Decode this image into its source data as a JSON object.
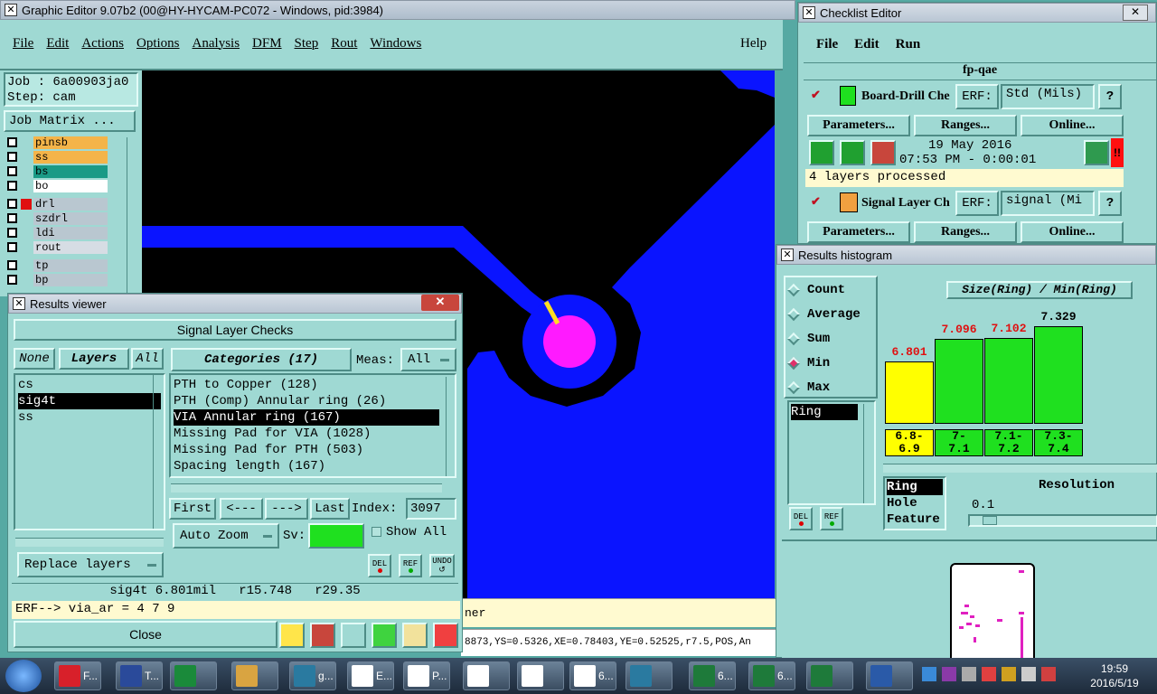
{
  "main_window": {
    "title": "Graphic Editor 9.07b2 (00@HY-HYCAM-PC072 - Windows, pid:3984)",
    "menu": [
      "File",
      "Edit",
      "Actions",
      "Options",
      "Analysis",
      "DFM",
      "Step",
      "Rout",
      "Windows"
    ],
    "help": "Help",
    "job": "Job : 6a00903ja0",
    "step": "Step: cam",
    "job_matrix": "Job Matrix ...",
    "layers": [
      {
        "name": "pinsb",
        "color": "#f4b449"
      },
      {
        "name": "ss",
        "color": "#f4b449"
      },
      {
        "name": "bs",
        "color": "#1a9a86"
      },
      {
        "name": "bo",
        "color": "#ffffff"
      },
      {
        "name": "drl",
        "color": "#b9c7d0"
      },
      {
        "name": "szdrl",
        "color": "#b9c7d0"
      },
      {
        "name": "ldi",
        "color": "#b9c7d0"
      },
      {
        "name": "rout",
        "color": "#d6dde4"
      },
      {
        "name": "tp",
        "color": "#b9c7d0"
      },
      {
        "name": "bp",
        "color": "#b9c7d0"
      }
    ],
    "status_line": "ner",
    "coord_line": "8873,YS=0.5326,XE=0.78403,YE=0.52525,r7.5,POS,An"
  },
  "results_viewer": {
    "title": "Results viewer",
    "header": "Signal Layer Checks",
    "none_btn": "None",
    "layers_btn": "Layers",
    "all_btn": "All",
    "layers": [
      "cs",
      "sig4t",
      "ss"
    ],
    "categories_label": "Categories (17)",
    "meas_label": "Meas:",
    "meas_value": "All",
    "categories": [
      "PTH to Copper (128)",
      "PTH (Comp) Annular ring (26)",
      "VIA Annular ring (167)",
      "Missing Pad for VIA (1028)",
      "Missing Pad for PTH (503)",
      "Spacing length (167)"
    ],
    "first": "First",
    "prev": "<---",
    "next": "--->",
    "last": "Last",
    "index_label": "Index:",
    "index_value": "3097",
    "auto_zoom": "Auto Zoom",
    "sv_label": "Sv:",
    "show_all": "Show All",
    "replace_layers": "Replace layers",
    "del": "DEL",
    "ref": "REF",
    "undo": "UNDO",
    "result_line": "sig4t 6.801mil   r15.748   r29.35",
    "erf_line": "ERF--> via_ar = 4 7 9",
    "close": "Close"
  },
  "checklist": {
    "title": "Checklist Editor",
    "menu": [
      "File",
      "Edit",
      "Run"
    ],
    "name": "fp-qae",
    "check1": {
      "name": "Board-Drill Che",
      "erf_label": "ERF:",
      "erf_value": "Std (Mils)",
      "help": "?"
    },
    "params": "Parameters...",
    "ranges": "Ranges...",
    "online": "Online...",
    "date": "19 May 2016",
    "time": "07:53 PM - 0:00:01",
    "alert": "!!",
    "status": "4 layers processed",
    "check2": {
      "name": "Signal Layer Ch",
      "erf_label": "ERF:",
      "erf_value": "signal (Mi",
      "help": "?"
    }
  },
  "histogram": {
    "title": "Results histogram",
    "options": [
      "Count",
      "Average",
      "Sum",
      "Min",
      "Max"
    ],
    "selected_option": "Min",
    "chart_title": "Size(Ring) / Min(Ring)",
    "field": "Ring",
    "fields": [
      "Ring",
      "Hole",
      "Feature"
    ],
    "resolution_label": "Resolution",
    "resolution_value": "0.1",
    "del": "DEL",
    "ref": "REF"
  },
  "chart_data": {
    "type": "bar",
    "title": "Size(Ring) / Min(Ring)",
    "categories": [
      "6.8-\n6.9",
      "7-\n7.1",
      "7.1-\n7.2",
      "7.3-\n7.4"
    ],
    "values": [
      6.801,
      7.096,
      7.102,
      7.329
    ],
    "value_labels": [
      "6.801",
      "7.096",
      "7.102",
      "7.329"
    ],
    "colors": [
      "#ffff00",
      "#1fe01f",
      "#1fe01f",
      "#1fe01f"
    ]
  },
  "taskbar": {
    "items": [
      {
        "label": "F...",
        "color": "#d8202a"
      },
      {
        "label": "T...",
        "color": "#2a4a9a"
      },
      {
        "label": "",
        "color": "#1a8a3a"
      },
      {
        "label": "",
        "color": "#d9a441"
      },
      {
        "label": "g...",
        "color": "#2a7aa0"
      },
      {
        "label": "E...",
        "color": "#ffffff"
      },
      {
        "label": "P...",
        "color": "#ffffff"
      },
      {
        "label": "",
        "color": "#ffffff"
      },
      {
        "label": "",
        "color": "#ffffff"
      },
      {
        "label": "6...",
        "color": "#ffffff"
      },
      {
        "label": "",
        "color": "#2a7aa0"
      },
      {
        "label": "6...",
        "color": "#1e7a3a"
      },
      {
        "label": "6...",
        "color": "#1e7a3a"
      },
      {
        "label": "",
        "color": "#1e7a3a"
      },
      {
        "label": "",
        "color": "#2a5aa8"
      }
    ],
    "time": "19:59",
    "date": "2016/5/19"
  }
}
